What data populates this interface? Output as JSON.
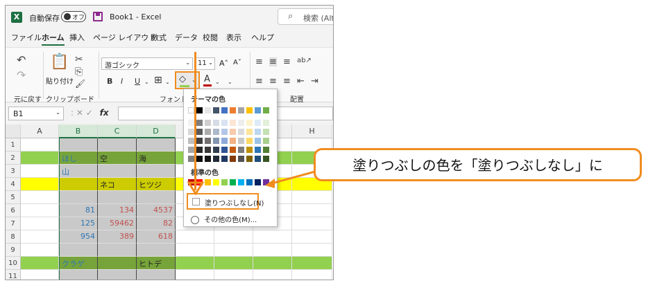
{
  "app": {
    "logo_letter": "X",
    "autosave_label": "自動保存",
    "autosave_state": "オフ",
    "doc_title": "Book1  -  Excel",
    "search_placeholder": "検索 (Alt"
  },
  "tabs": [
    {
      "label": "ファイル",
      "active": false
    },
    {
      "label": "ホーム",
      "active": true
    },
    {
      "label": "挿入",
      "active": false
    },
    {
      "label": "ページ レイアウト",
      "active": false
    },
    {
      "label": "数式",
      "active": false
    },
    {
      "label": "データ",
      "active": false
    },
    {
      "label": "校閲",
      "active": false
    },
    {
      "label": "表示",
      "active": false
    },
    {
      "label": "ヘルプ",
      "active": false
    }
  ],
  "ribbon": {
    "undo_group_label": "元に戻す",
    "paste_label": "貼り付け",
    "clipboard_label": "クリップボード",
    "font_label": "フォント",
    "align_label": "配置",
    "font_name": "游ゴシック",
    "font_size": "11",
    "bold": "B",
    "italic": "I",
    "underline": "U",
    "font_color_letter": "A",
    "grow_font": "A˄",
    "shrink_font": "A˅",
    "fill_color_bar": "#92d050",
    "font_color_bar": "#c00000",
    "dropdown_glyph": "⌄",
    "border_glyph": "⊞",
    "fill_glyph": "◇",
    "undo_glyph": "↶",
    "redo_glyph": "↷",
    "paste_glyph": "📋",
    "cut_glyph": "✂",
    "copy_glyph": "⎘",
    "painter_glyph": "🖌",
    "orient_glyph": "ab↗",
    "dialog_glyph": "⌞"
  },
  "formula": {
    "cell_ref": "B1",
    "cancel": "✕",
    "enter": "✓",
    "fx": "fx",
    "sep": ":"
  },
  "grid": {
    "columns": [
      "A",
      "B",
      "C",
      "D",
      "E",
      "F",
      "G",
      "H"
    ],
    "rows": [
      "1",
      "2",
      "3",
      "4",
      "5",
      "6",
      "7",
      "8",
      "9",
      "10",
      "11"
    ],
    "cells": {
      "B2": "ほし",
      "C2": "空",
      "D2": "海",
      "B3": "山",
      "C4": "ネコ",
      "D4": "ヒツジ",
      "B6": "81",
      "C6": "134",
      "D6": "4537",
      "B7": "125",
      "C7": "59462",
      "D7": "82",
      "B8": "954",
      "C8": "389",
      "D8": "618",
      "B10": "クラゲ",
      "D10": "ヒトデ"
    }
  },
  "popup": {
    "theme_heading": "テーマの色",
    "standard_heading": "標準の色",
    "no_fill": "塗りつぶしなし(N)",
    "more_colors": "その他の色(M)...",
    "theme_top": [
      "#ffffff",
      "#000000",
      "#e7e6e6",
      "#44546a",
      "#4472c4",
      "#ed7d31",
      "#a5a5a5",
      "#ffc000",
      "#5b9bd5",
      "#70ad47"
    ],
    "theme_shades": [
      [
        "#f2f2f2",
        "#7f7f7f",
        "#d0cece",
        "#d6dce4",
        "#d9e2f3",
        "#fbe5d5",
        "#ededed",
        "#fff2cc",
        "#deebf6",
        "#e2efd9"
      ],
      [
        "#d8d8d8",
        "#595959",
        "#aeabab",
        "#adb9ca",
        "#b4c6e7",
        "#f7cbac",
        "#dbdbdb",
        "#fee599",
        "#bdd7ee",
        "#c5e0b3"
      ],
      [
        "#bfbfbf",
        "#3f3f3f",
        "#757070",
        "#8496b0",
        "#8eaadb",
        "#f4b183",
        "#c9c9c9",
        "#ffd965",
        "#9cc3e5",
        "#a8d08d"
      ],
      [
        "#a5a5a5",
        "#262626",
        "#3a3838",
        "#323f4f",
        "#2f5496",
        "#c55a11",
        "#7b7b7b",
        "#bf9000",
        "#2e75b5",
        "#538135"
      ],
      [
        "#7f7f7f",
        "#0c0c0c",
        "#171616",
        "#222a35",
        "#1f3864",
        "#833c0b",
        "#525252",
        "#7f6000",
        "#1e4e79",
        "#375623"
      ]
    ],
    "standard": [
      "#c00000",
      "#ff0000",
      "#ffc000",
      "#ffff00",
      "#92d050",
      "#00b050",
      "#00b0f0",
      "#0070c0",
      "#002060",
      "#7030a0"
    ]
  },
  "callout": {
    "text": "塗りつぶしの色を「塗りつぶしなし」に"
  },
  "colors": {
    "accent": "#f08c1e",
    "excel_green": "#1d6f42",
    "row_green": "#92d050",
    "row_yellow": "#ffff00",
    "selection_gray": "#c9c9c9",
    "green_sel": "#77a43a",
    "yellow_sel": "#cccc00",
    "blue_text": "#2e75b5",
    "red_text": "#c0504d",
    "text_dark": "#222"
  }
}
